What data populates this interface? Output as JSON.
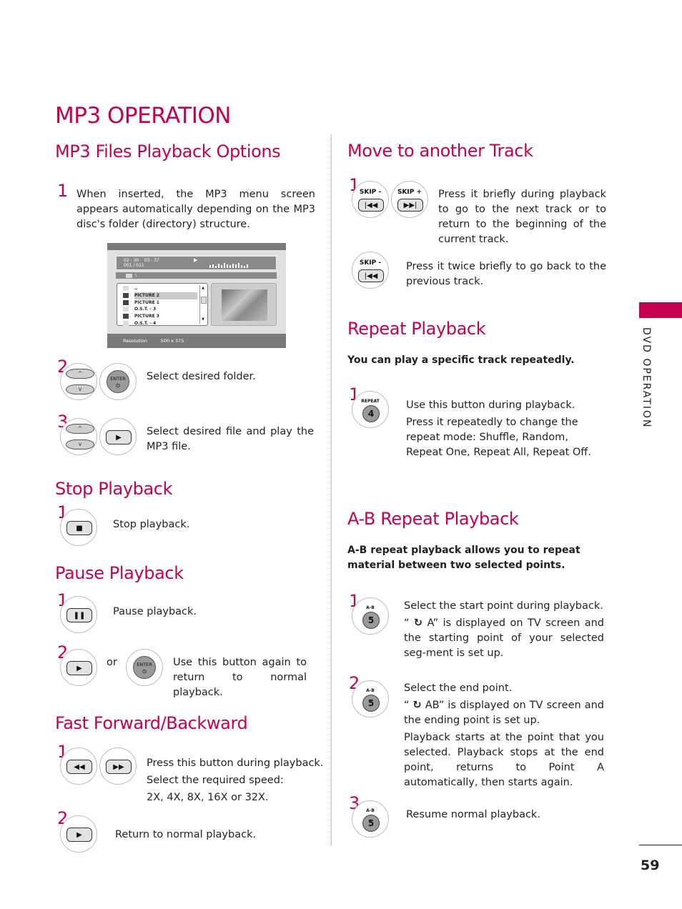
{
  "page": {
    "title": "MP3 OPERATION",
    "side_label": "DVD OPERATION",
    "page_number": "59",
    "accent_color": "#c4004f"
  },
  "mp3_options": {
    "heading": "MP3 Files Playback Options",
    "step1_num": "1",
    "step1_text": "When inserted, the MP3 menu screen appears automatically depending on the MP3 disc's folder (directory) structure.",
    "screen": {
      "time_elapsed": "02 : 30",
      "time_total": "03 : 37",
      "track_counter": "001 / 011",
      "path": "\\",
      "files": [
        {
          "name": "..",
          "type": "folder"
        },
        {
          "name": "PICTURE 2",
          "type": "picture",
          "selected": true
        },
        {
          "name": "PICTURE 1",
          "type": "picture"
        },
        {
          "name": "O.S.T. - 3",
          "type": "music"
        },
        {
          "name": "PICTURE 3",
          "type": "picture"
        },
        {
          "name": "O.S.T. - 4",
          "type": "music"
        }
      ],
      "resolution_label": "Resolution",
      "resolution_value": "500   x   375"
    },
    "step2_num": "2",
    "step2_text": "Select desired folder.",
    "step3_num": "3",
    "step3_text": "Select desired file and play the MP3 file.",
    "enter_label": "ENTER"
  },
  "stop": {
    "heading": "Stop Playback",
    "step1_num": "1",
    "step1_text": "Stop playback."
  },
  "pause": {
    "heading": "Pause Playback",
    "step1_num": "1",
    "step1_text": "Pause playback.",
    "step2_num": "2",
    "or_text": "or",
    "step2_text": "Use this button again to return to normal playback.",
    "enter_label": "ENTER"
  },
  "ffwd": {
    "heading": "Fast Forward/Backward",
    "step1_num": "1",
    "step1_line1": "Press this button during playback.",
    "step1_line2": "Select the required speed:",
    "step1_line3": "2X, 4X, 8X, 16X or 32X.",
    "step2_num": "2",
    "step2_text": "Return to normal playback."
  },
  "move_track": {
    "heading": "Move to another Track",
    "step1_num": "1",
    "skip_minus": "SKIP -",
    "skip_plus": "SKIP +",
    "text1": "Press it briefly during playback to go to the next track or to return to the beginning of the current track.",
    "text2": "Press it twice briefly to go back to the previous track."
  },
  "repeat": {
    "heading": "Repeat Playback",
    "intro": "You can play a specific track repeatedly.",
    "step1_num": "1",
    "button_label": "REPEAT",
    "button_num": "4",
    "text1": "Use this button during playback.",
    "text2": "Press it repeatedly to change the repeat mode: Shuffle, Random, Repeat One, Repeat All, Repeat Off."
  },
  "ab_repeat": {
    "heading": "A-B Repeat Playback",
    "intro": "A-B repeat playback allows you to repeat material between two selected points.",
    "button_label": "A-B",
    "button_num": "5",
    "step1_num": "1",
    "step1_text1": "Select the start point during playback.",
    "step1_text2_pre": "“",
    "step1_text2": " A” is displayed on TV screen and the starting point of your selected seg-ment is set up.",
    "step2_num": "2",
    "step2_text1": "Select the end point.",
    "step2_text2_pre": "“",
    "step2_text2": " AB” is displayed on TV screen and the ending point is set up.",
    "step2_text3": "Playback starts at the point that you selected. Playback stops at the end point, returns to Point A automatically, then starts again.",
    "step3_num": "3",
    "step3_text": "Resume normal playback."
  }
}
